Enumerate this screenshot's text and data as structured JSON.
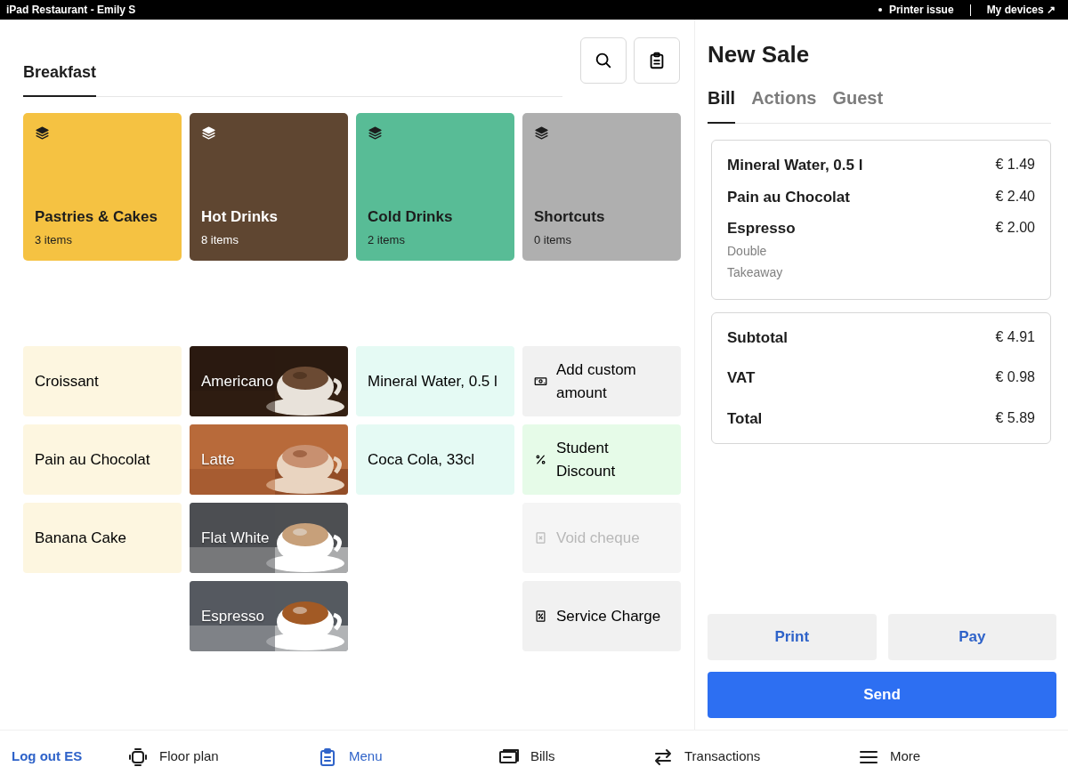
{
  "status_bar": {
    "title": "iPad Restaurant - Emily S",
    "alert": "Printer issue",
    "devices": "My devices",
    "devices_arrow": "↗"
  },
  "menu_tabs": [
    {
      "label": "Breakfast",
      "selected": true
    }
  ],
  "categories": [
    {
      "name": "Pastries & Cakes",
      "count": "3 items",
      "color": "#f5c242"
    },
    {
      "name": "Hot Drinks",
      "count": "8 items",
      "color": "#5f4631"
    },
    {
      "name": "Cold Drinks",
      "count": "2 items",
      "color": "#58bc96"
    },
    {
      "name": "Shortcuts",
      "count": "0 items",
      "color": "#afafaf"
    }
  ],
  "product_columns": [
    {
      "items": [
        {
          "kind": "product",
          "label": "Croissant",
          "color": "#fdf6e0"
        },
        {
          "kind": "product",
          "label": "Pain au Chocolat",
          "color": "#fdf6e0"
        },
        {
          "kind": "product",
          "label": "Banana Cake",
          "color": "#fdf6e0"
        }
      ]
    },
    {
      "items": [
        {
          "kind": "picture",
          "label": "Americano"
        },
        {
          "kind": "picture",
          "label": "Latte"
        },
        {
          "kind": "picture",
          "label": "Flat White"
        },
        {
          "kind": "picture",
          "label": "Espresso"
        }
      ]
    },
    {
      "items": [
        {
          "kind": "product",
          "label": "Mineral Water, 0.5 l",
          "color": "#e5faf4"
        },
        {
          "kind": "product",
          "label": "Coca Cola, 33cl",
          "color": "#e5faf4"
        }
      ]
    },
    {
      "items": [
        {
          "kind": "action",
          "label": "Add custom amount",
          "color": "#f1f1f1",
          "disabled": false
        },
        {
          "kind": "action",
          "label": "Student Discount",
          "color": "#e6fbe8",
          "disabled": false
        },
        {
          "kind": "action",
          "label": "Void cheque",
          "color": "#f5f5f5",
          "disabled": true
        },
        {
          "kind": "action",
          "label": "Service Charge",
          "color": "#f1f1f1",
          "disabled": false
        }
      ]
    }
  ],
  "sale": {
    "title": "New Sale",
    "tabs": [
      {
        "label": "Bill",
        "selected": true
      },
      {
        "label": "Actions",
        "selected": false
      },
      {
        "label": "Guest",
        "selected": false
      }
    ],
    "lines": [
      {
        "name": "Mineral Water, 0.5 l",
        "price": "€ 1.49"
      },
      {
        "name": "Pain au Chocolat",
        "price": "€ 2.40"
      },
      {
        "name": "Espresso",
        "price": "€ 2.00",
        "modifiers": [
          "Double",
          "Takeaway"
        ]
      }
    ],
    "totals": [
      {
        "label": "Subtotal",
        "value": "€ 4.91"
      },
      {
        "label": "VAT",
        "value": "€ 0.98"
      },
      {
        "label": "Total",
        "value": "€ 5.89"
      }
    ],
    "buttons": [
      {
        "label": "Print",
        "kind": "secondary"
      },
      {
        "label": "Pay",
        "kind": "secondary"
      },
      {
        "label": "Send",
        "kind": "primary"
      }
    ]
  },
  "bottom_nav": [
    {
      "kind": "link",
      "label": "Log out ES"
    },
    {
      "kind": "floor",
      "label": "Floor plan",
      "selected": false
    },
    {
      "kind": "menu",
      "label": "Menu",
      "selected": true
    },
    {
      "kind": "bills",
      "label": "Bills",
      "selected": false
    },
    {
      "kind": "transactions",
      "label": "Transactions",
      "selected": false
    },
    {
      "kind": "more",
      "label": "More",
      "selected": false
    }
  ]
}
